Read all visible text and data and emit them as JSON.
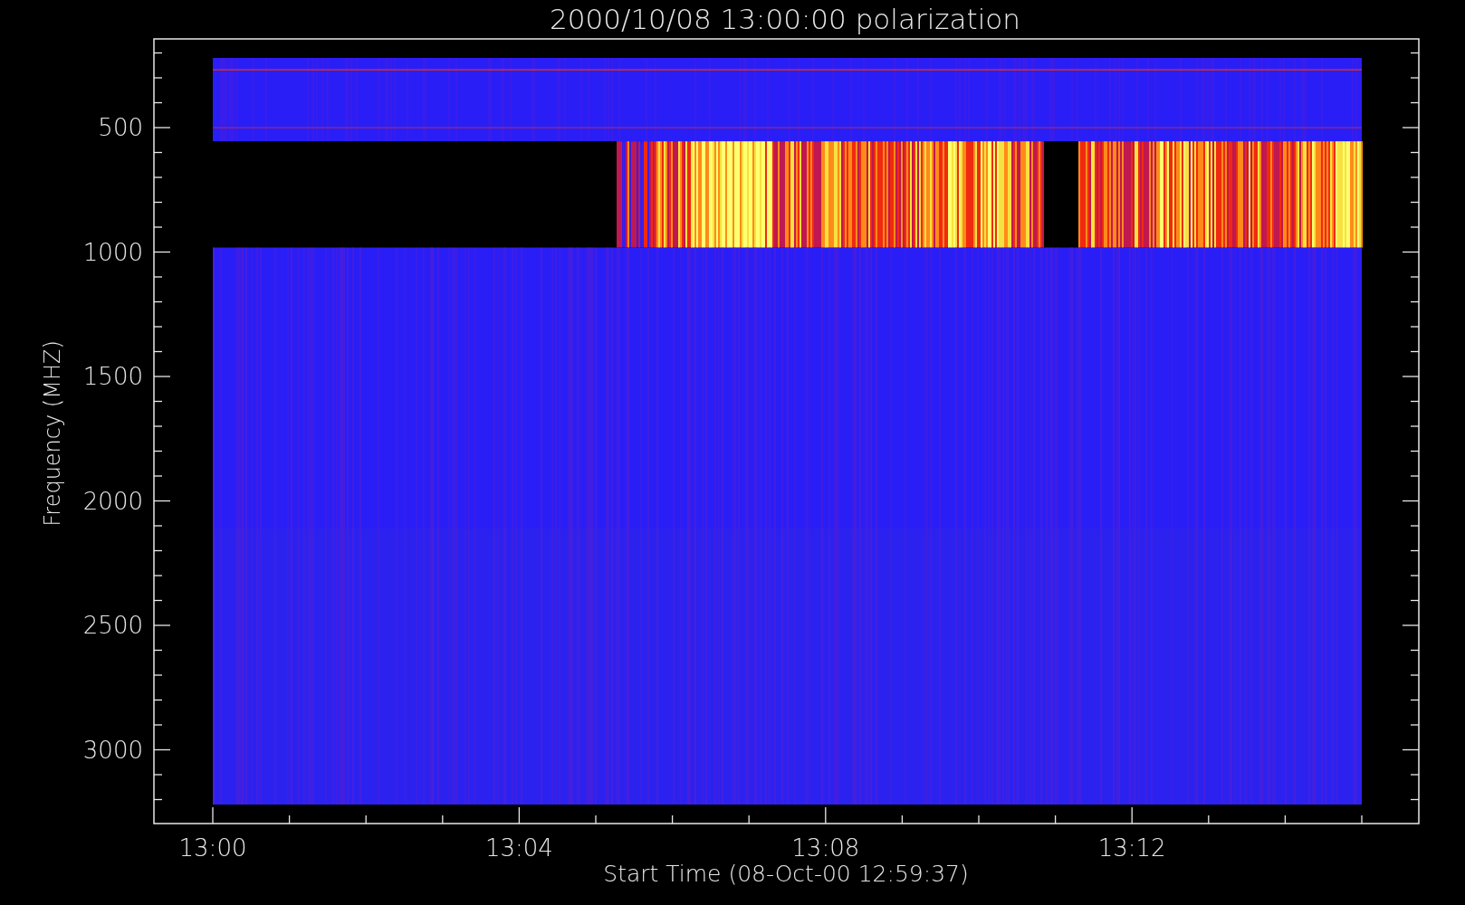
{
  "title": "2000/10/08 13:00:00 polarization",
  "y_axis": {
    "label": "Frequency (MHZ)",
    "ticks": [
      "500",
      "1000",
      "1500",
      "2000",
      "2500",
      "3000"
    ]
  },
  "x_axis": {
    "label": "Start Time (08-Oct-00 12:59:37)",
    "ticks": [
      "13:00",
      "13:04",
      "13:08",
      "13:12"
    ]
  }
}
